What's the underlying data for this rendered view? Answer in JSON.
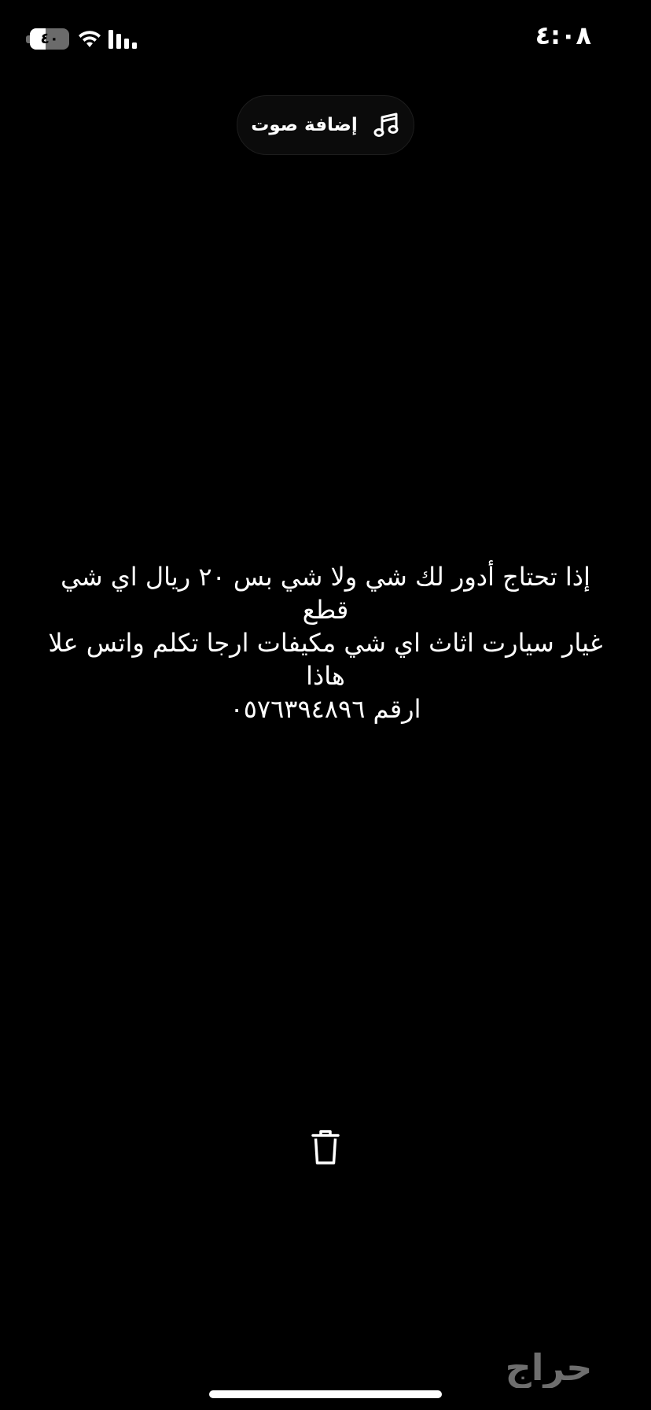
{
  "status_bar": {
    "time": "٤:٠٨",
    "battery_label": "٤٠",
    "battery_level": 0.4
  },
  "add_sound": {
    "label": "إضافة صوت",
    "icon": "music-note-icon"
  },
  "caption": {
    "lines": [
      "إذا تحتاج أدور لك شي ولا شي بس ٢٠ ريال اي شي قطع",
      "غيار سيارت اثاث اي شي مكيفات ارجا تكلم واتس علا هاذا",
      "ارقم ٠٥٧٦٣٩٤٨٩٦"
    ]
  },
  "actions": {
    "delete_icon": "trash-icon"
  },
  "watermark": {
    "text": "حراج",
    "color": "#6e6e6e"
  },
  "colors": {
    "background": "#000000",
    "text": "#ffffff",
    "battery_track": "#6b6b6b"
  }
}
